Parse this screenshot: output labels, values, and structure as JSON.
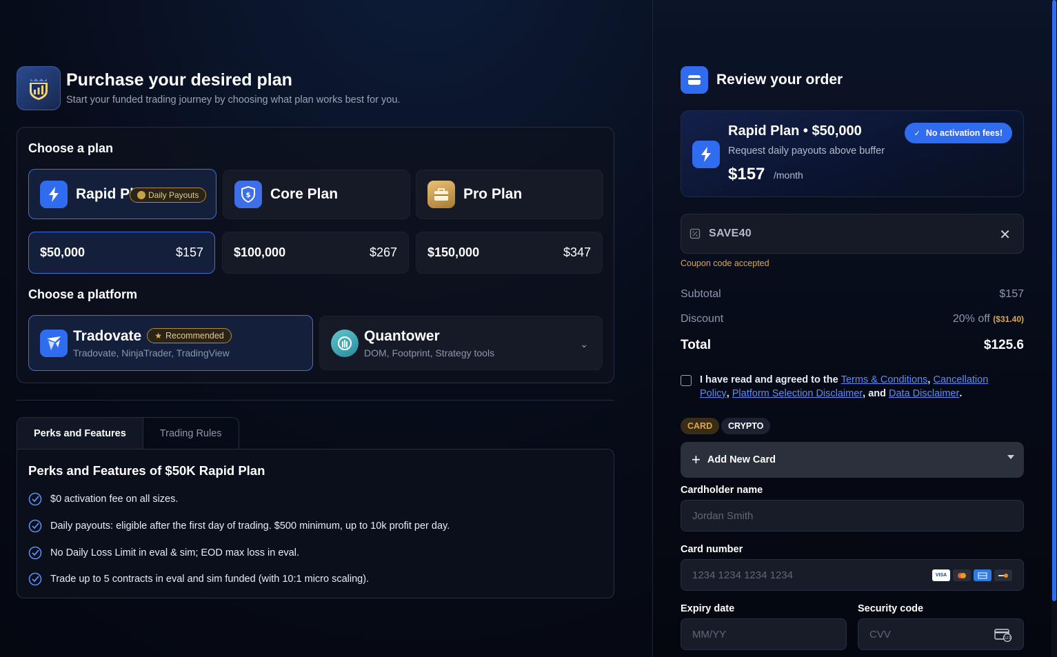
{
  "header": {
    "title": "Purchase your desired plan",
    "subtitle": "Start your funded trading journey by choosing what plan works best for you."
  },
  "plans": {
    "section_label": "Choose a plan",
    "items": [
      {
        "name": "Rapid Plan",
        "badge": "Daily Payouts",
        "selected": true
      },
      {
        "name": "Core Plan",
        "selected": false
      },
      {
        "name": "Pro Plan",
        "selected": false
      }
    ],
    "sizes": [
      {
        "amount": "$50,000",
        "price": "$157",
        "selected": true
      },
      {
        "amount": "$100,000",
        "price": "$267",
        "selected": false
      },
      {
        "amount": "$150,000",
        "price": "$347",
        "selected": false
      }
    ]
  },
  "platforms": {
    "section_label": "Choose a platform",
    "items": [
      {
        "name": "Tradovate",
        "badge": "Recommended",
        "sub": "Tradovate, NinjaTrader, TradingView",
        "selected": true
      },
      {
        "name": "Quantower",
        "sub": "DOM, Footprint, Strategy tools",
        "selected": false
      }
    ]
  },
  "tabs": [
    "Perks and Features",
    "Trading Rules"
  ],
  "perks": {
    "title": "Perks and Features of $50K Rapid Plan",
    "items": [
      "$0 activation fee on all sizes.",
      "Daily payouts: eligible after the first day of trading. $500 minimum, up to 10k profit per day.",
      "No Daily Loss Limit in eval & sim; EOD max loss in eval.",
      "Trade up to 5 contracts in eval and sim funded (with 10:1 micro scaling)."
    ]
  },
  "review": {
    "title": "Review your order",
    "order": {
      "name": "Rapid Plan • $50,000",
      "desc": "Request daily payouts above buffer",
      "price": "$157",
      "per": "/month",
      "badge": "No activation fees!"
    },
    "coupon": {
      "code": "SAVE40",
      "status": "Coupon code accepted"
    },
    "subtotal_label": "Subtotal",
    "subtotal": "$157",
    "discount_label": "Discount",
    "discount": "20% off",
    "discount_amount": "($31.40)",
    "total_label": "Total",
    "total": "$125.6",
    "agree": {
      "prefix": "I have read and agreed to the",
      "terms": "Terms & Conditions",
      "cancellation": "Cancellation Policy",
      "platform": "Platform Selection Disclaimer",
      "and": "and",
      "data": "Data Disclaimer"
    },
    "pay_tabs": [
      "CARD",
      "CRYPTO"
    ],
    "add_card": "Add New Card",
    "fields": {
      "cardholder_label": "Cardholder name",
      "cardholder_placeholder": "Jordan Smith",
      "card_number_label": "Card number",
      "card_number_placeholder": "1234 1234 1234 1234",
      "expiry_label": "Expiry date",
      "expiry_placeholder": "MM/YY",
      "cvv_label": "Security code",
      "cvv_placeholder": "CVV"
    },
    "card_brands": [
      "VISA",
      "mastercard-icon",
      "amex-icon",
      "discover-icon"
    ]
  },
  "colors": {
    "accent": "#2f6cf0",
    "gold": "#e0a64a",
    "selected_border": "#3f6fe0"
  }
}
